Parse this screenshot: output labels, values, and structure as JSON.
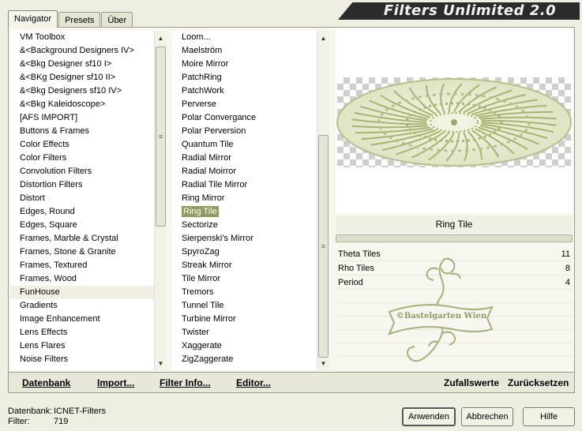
{
  "app": {
    "logo_title": "Filters Unlimited 2.0"
  },
  "tabs": [
    {
      "label": "Navigator",
      "active": true
    },
    {
      "label": "Presets",
      "active": false
    },
    {
      "label": "Über",
      "active": false
    }
  ],
  "categories": [
    "VM Toolbox",
    "&<Background Designers IV>",
    "&<Bkg Designer sf10 I>",
    "&<BKg Designer sf10 II>",
    "&<Bkg Designers sf10 IV>",
    "&<Bkg Kaleidoscope>",
    "[AFS IMPORT]",
    "Buttons & Frames",
    "Color Effects",
    "Color Filters",
    "Convolution Filters",
    "Distortion Filters",
    "Distort",
    "Edges, Round",
    "Edges, Square",
    "Frames, Marble & Crystal",
    "Frames, Stone & Granite",
    "Frames, Textured",
    "Frames, Wood",
    "FunHouse",
    "Gradients",
    "Image Enhancement",
    "Lens Effects",
    "Lens Flares",
    "Noise Filters"
  ],
  "selected_category": "FunHouse",
  "filters": [
    "Loom...",
    "Maelström",
    "Moire Mirror",
    "PatchRing",
    "PatchWork",
    "Perverse",
    "Polar Convergance",
    "Polar Perversion",
    "Quantum Tile",
    "Radial Mirror",
    "Radial Moirror",
    "Radial Tile Mirror",
    "Ring Mirror",
    "Ring Tile",
    "Sectorize",
    "Sierpenski's Mirror",
    "SpyroZag",
    "Streak Mirror",
    "Tile Mirror",
    "Tremors",
    "Tunnel Tile",
    "Turbine Mirror",
    "Twister",
    "Xaggerate",
    "ZigZaggerate"
  ],
  "selected_filter": "Ring Tile",
  "filter_panel": {
    "title": "Ring Tile",
    "params": [
      {
        "name": "Theta Tiles",
        "value": "11"
      },
      {
        "name": "Rho Tiles",
        "value": "8"
      },
      {
        "name": "Period",
        "value": "4"
      }
    ],
    "watermark_text": "©Bastelgarten Wien"
  },
  "actions": {
    "datenbank": "Datenbank",
    "import": "Import...",
    "filter_info": "Filter Info...",
    "editor": "Editor...",
    "zufallswerte": "Zufallswerte",
    "zuruecksetzen": "Zurücksetzen"
  },
  "footer": {
    "db_label": "Datenbank:",
    "db_value": "ICNET-Filters",
    "filter_label": "Filter:",
    "filter_value": "719"
  },
  "buttons": {
    "apply": "Anwenden",
    "cancel": "Abbrechen",
    "help": "Hilfe"
  },
  "colors": {
    "accent": "#8f9b62",
    "preview_green": "#b7c08a"
  }
}
